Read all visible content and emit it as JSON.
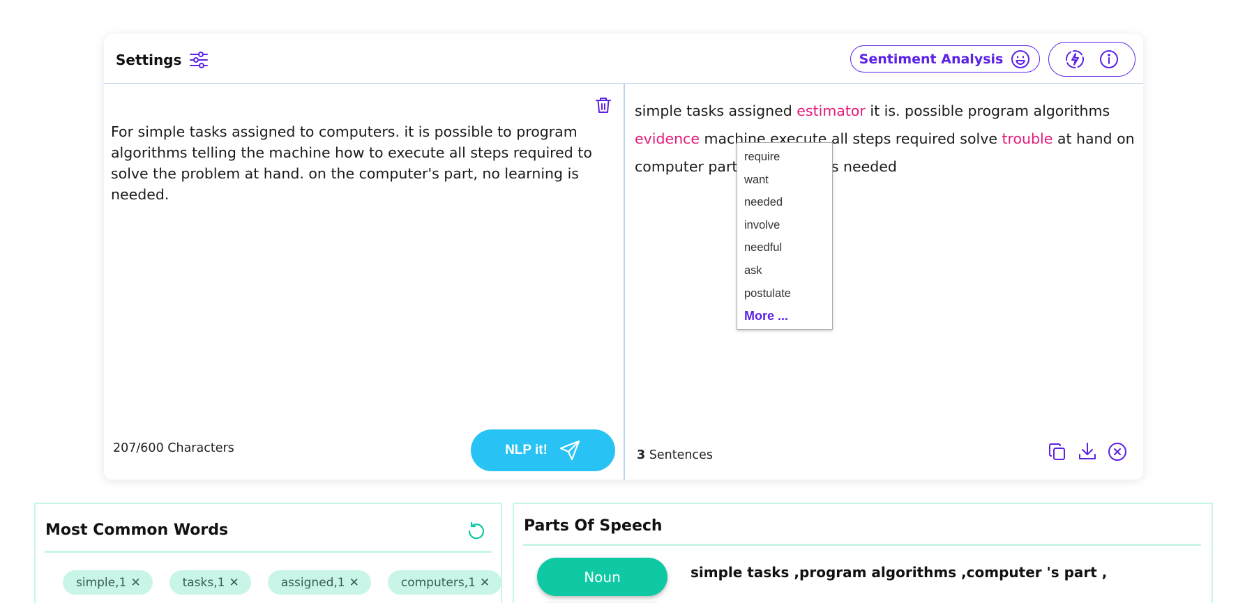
{
  "header": {
    "settings_label": "Settings",
    "sentiment_label": "Sentiment Analysis"
  },
  "input": {
    "text": "For simple tasks assigned to computers. it is possible to program algorithms telling the machine how to execute all steps required to solve the problem at hand. on the computer's part, no learning is needed.",
    "char_count": "207/600 Characters",
    "submit_label": "NLP it!"
  },
  "output": {
    "segments": [
      {
        "t": "simple tasks assigned ",
        "hl": false
      },
      {
        "t": "estimator",
        "hl": true
      },
      {
        "t": " it is. possible program algorithms ",
        "hl": false
      },
      {
        "t": "evidence",
        "hl": true
      },
      {
        "t": " machine execute all steps required solve ",
        "hl": false
      },
      {
        "t": "trouble",
        "hl": true
      },
      {
        "t": " at hand on computer part no learning is needed",
        "hl": false
      }
    ],
    "sentence_count": "3",
    "sentence_label": " Sentences"
  },
  "synonyms": {
    "options": [
      "require",
      "want",
      "needed",
      "involve",
      "needful",
      "ask",
      "postulate"
    ],
    "more_label": "More ..."
  },
  "common_words": {
    "title": "Most Common Words",
    "chips": [
      "simple,1",
      "tasks,1",
      "assigned,1",
      "computers,1"
    ]
  },
  "pos": {
    "title": "Parts Of Speech",
    "noun_label": "Noun",
    "noun_words": "simple tasks ,program algorithms ,computer 's part ,"
  },
  "colors": {
    "accent_purple": "#5b21e6",
    "highlight_pink": "#e3197a",
    "nlp_button": "#28c3f4",
    "chip_bg": "#c8f5e8",
    "noun_green": "#0ec9a3"
  }
}
